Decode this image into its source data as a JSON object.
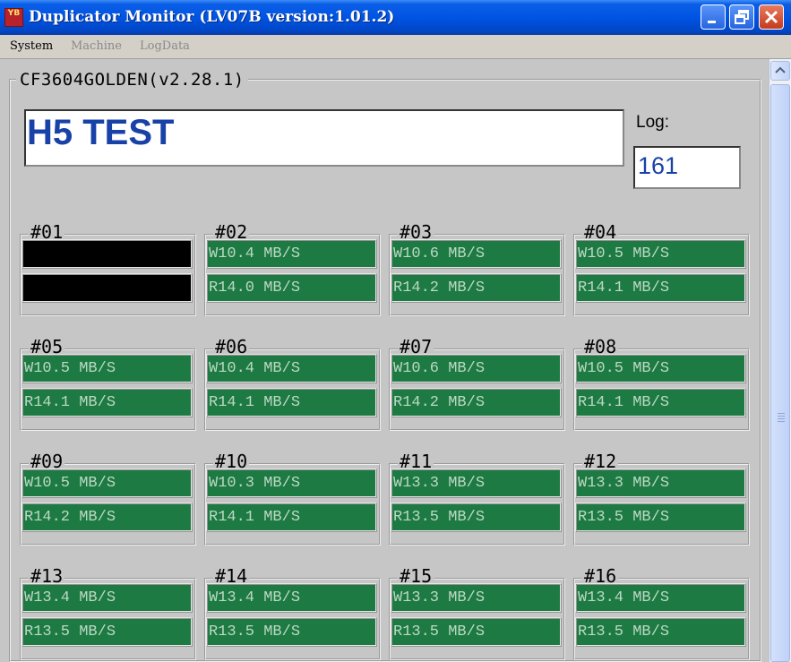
{
  "window": {
    "title": "Duplicator Monitor (LV07B version:1.01.2)",
    "icon_label": "YB"
  },
  "menu": [
    {
      "label": "System",
      "enabled": true
    },
    {
      "label": "Machine",
      "enabled": false
    },
    {
      "label": "LogData",
      "enabled": false
    }
  ],
  "group_label": "CF3604GOLDEN(v2.28.1)",
  "job_text": "H5 TEST",
  "log": {
    "label": "Log:",
    "value": "161"
  },
  "slots": [
    {
      "id": "#01",
      "write": "",
      "read": "",
      "status": "empty"
    },
    {
      "id": "#02",
      "write": "W10.4 MB/S",
      "read": "R14.0 MB/S",
      "status": "active"
    },
    {
      "id": "#03",
      "write": "W10.6 MB/S",
      "read": "R14.2 MB/S",
      "status": "active"
    },
    {
      "id": "#04",
      "write": "W10.5 MB/S",
      "read": "R14.1 MB/S",
      "status": "active"
    },
    {
      "id": "#05",
      "write": "W10.5 MB/S",
      "read": "R14.1 MB/S",
      "status": "active"
    },
    {
      "id": "#06",
      "write": "W10.4 MB/S",
      "read": "R14.1 MB/S",
      "status": "active"
    },
    {
      "id": "#07",
      "write": "W10.6 MB/S",
      "read": "R14.2 MB/S",
      "status": "active"
    },
    {
      "id": "#08",
      "write": "W10.5 MB/S",
      "read": "R14.1 MB/S",
      "status": "active"
    },
    {
      "id": "#09",
      "write": "W10.5 MB/S",
      "read": "R14.2 MB/S",
      "status": "active"
    },
    {
      "id": "#10",
      "write": "W10.3 MB/S",
      "read": "R14.1 MB/S",
      "status": "active"
    },
    {
      "id": "#11",
      "write": "W13.3 MB/S",
      "read": "R13.5 MB/S",
      "status": "active"
    },
    {
      "id": "#12",
      "write": "W13.3 MB/S",
      "read": "R13.5 MB/S",
      "status": "active"
    },
    {
      "id": "#13",
      "write": "W13.4 MB/S",
      "read": "R13.5 MB/S",
      "status": "active"
    },
    {
      "id": "#14",
      "write": "W13.4 MB/S",
      "read": "R13.5 MB/S",
      "status": "active"
    },
    {
      "id": "#15",
      "write": "W13.3 MB/S",
      "read": "R13.5 MB/S",
      "status": "active"
    },
    {
      "id": "#16",
      "write": "W13.4 MB/S",
      "read": "R13.5 MB/S",
      "status": "active"
    }
  ],
  "colors": {
    "title_bar": "#0054e3",
    "bar_active": "#1d7a42",
    "bar_text": "#bcd8c4",
    "bar_empty": "#000000",
    "job_text": "#1842a8"
  },
  "icons": [
    "app-icon",
    "minimize-icon",
    "restore-icon",
    "close-icon",
    "scroll-up-arrow-icon",
    "scroll-thumb-grip-icon"
  ]
}
